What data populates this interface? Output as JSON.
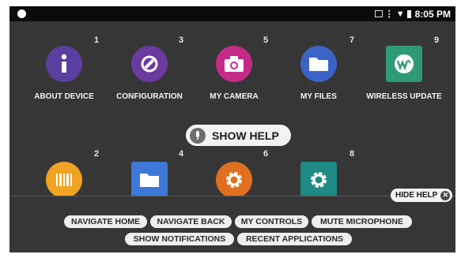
{
  "status_bar": {
    "time": "8:05 PM"
  },
  "apps_top": [
    {
      "number": "1",
      "label": "ABOUT DEVICE",
      "icon": "info-icon",
      "color": "#5b3fa0"
    },
    {
      "number": "3",
      "label": "CONFIGURATION",
      "icon": "config-icon",
      "color": "#6a3a9e"
    },
    {
      "number": "5",
      "label": "MY CAMERA",
      "icon": "camera-icon",
      "color": "#c42b86"
    },
    {
      "number": "7",
      "label": "MY FILES",
      "icon": "folder-icon",
      "color": "#3b63c6"
    },
    {
      "number": "9",
      "label": "WIRELESS UPDATE",
      "icon": "wireless-update-icon",
      "color": "#2e9b74"
    }
  ],
  "apps_bottom": [
    {
      "number": "2",
      "icon": "barcode-icon",
      "color": "#f0a323"
    },
    {
      "number": "4",
      "icon": "folder-icon",
      "color": "#3e78d8"
    },
    {
      "number": "6",
      "icon": "gear-icon",
      "color": "#e0701f"
    },
    {
      "number": "8",
      "icon": "settings-icon",
      "color": "#1f8a86"
    }
  ],
  "show_help": {
    "label": "SHOW HELP"
  },
  "hide_help": {
    "label": "HIDE HELP"
  },
  "commands_row1": [
    "NAVIGATE HOME",
    "NAVIGATE BACK",
    "MY CONTROLS",
    "MUTE MICROPHONE"
  ],
  "commands_row2": [
    "SHOW NOTIFICATIONS",
    "RECENT APPLICATIONS"
  ]
}
